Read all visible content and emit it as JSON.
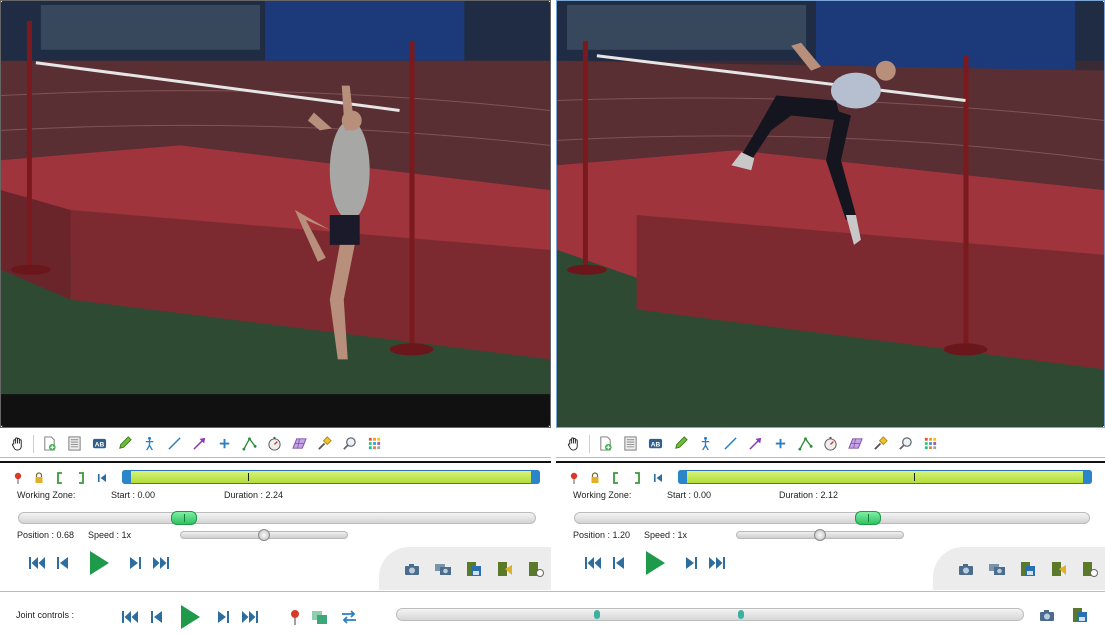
{
  "colors": {
    "accent_green": "#1e9a4a",
    "working_zone_green": "#b2dd3a",
    "handle_blue": "#2b86c9",
    "nav_blue": "#2e6e9e"
  },
  "players": [
    {
      "id": "left",
      "working_zone_label": "Working Zone:",
      "start": "Start : 0.00",
      "duration": "Duration : 2.24",
      "position": "Position : 0.68",
      "speed": "Speed : 1x",
      "position_fraction": 0.32,
      "speed_fraction": 0.5,
      "working_zone_marker_fraction": 0.3
    },
    {
      "id": "right",
      "working_zone_label": "Working Zone:",
      "start": "Start : 0.00",
      "duration": "Duration : 2.12",
      "position": "Position : 1.20",
      "speed": "Speed : 1x",
      "position_fraction": 0.57,
      "speed_fraction": 0.5,
      "working_zone_marker_fraction": 0.57
    }
  ],
  "toolbar_icons": [
    "hand-icon",
    "add-keyframe-icon",
    "comments-icon",
    "text-label-icon",
    "pencil-icon",
    "human-model-icon",
    "line-icon",
    "arrow-icon",
    "cross-marker-icon",
    "angle-icon",
    "chronometer-icon",
    "grid-icon",
    "spotlight-icon",
    "magnifier-icon",
    "color-palette-icon"
  ],
  "joint": {
    "label": "Joint controls :",
    "marker_fractions": [
      0.315,
      0.545
    ]
  }
}
